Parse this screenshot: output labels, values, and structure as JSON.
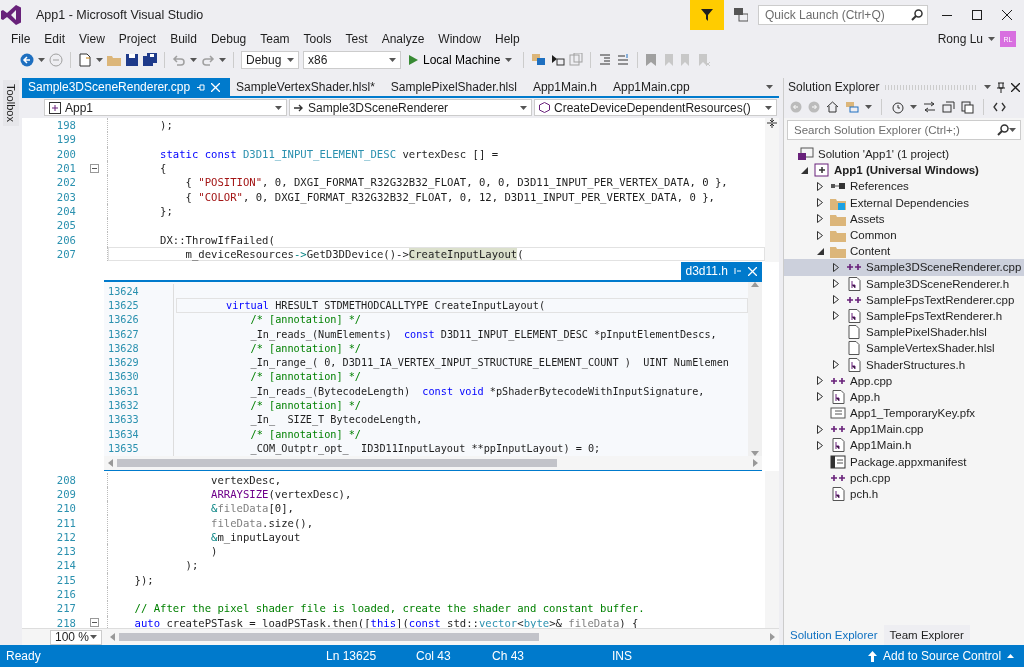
{
  "window": {
    "title": "App1 - Microsoft Visual Studio",
    "quick_launch": {
      "placeholder": "Quick Launch (Ctrl+Q)"
    }
  },
  "menu": [
    "File",
    "Edit",
    "View",
    "Project",
    "Build",
    "Debug",
    "Team",
    "Tools",
    "Test",
    "Analyze",
    "Window",
    "Help"
  ],
  "account": {
    "name": "Rong Lu",
    "initials": "RL"
  },
  "toolbar": {
    "configuration": "Debug",
    "platform": "x86",
    "run": "Local Machine"
  },
  "toolbox": {
    "label": "Toolbox"
  },
  "tabs": [
    {
      "label": "Sample3DSceneRenderer.cpp",
      "selected": true
    },
    {
      "label": "SampleVertexShader.hlsl*",
      "selected": false
    },
    {
      "label": "SamplePixelShader.hlsl",
      "selected": false
    },
    {
      "label": "App1Main.h",
      "selected": false
    },
    {
      "label": "App1Main.cpp",
      "selected": false
    }
  ],
  "navigation": [
    "App1",
    "Sample3DSceneRenderer",
    "CreateDeviceDependentResources()"
  ],
  "editor": {
    "top_lines": [
      {
        "number": "198",
        "tokens": [
          {
            "kind": "plain",
            "text": "        );"
          }
        ]
      },
      {
        "number": "199"
      },
      {
        "number": "200",
        "tokens": [
          {
            "kind": "keyword",
            "text": "        static const "
          },
          {
            "kind": "type",
            "text": "D3D11_INPUT_ELEMENT_DESC"
          },
          {
            "kind": "plain",
            "text": " vertexDesc [] ="
          }
        ]
      },
      {
        "number": "201",
        "fold": true,
        "tokens": [
          {
            "kind": "plain",
            "text": "        {"
          }
        ]
      },
      {
        "number": "202",
        "tokens": [
          {
            "kind": "plain",
            "text": "            { "
          },
          {
            "kind": "string",
            "text": "\"POSITION\""
          },
          {
            "kind": "plain",
            "text": ", 0, DXGI_FORMAT_R32G32B32_FLOAT, 0, 0, D3D11_INPUT_PER_VERTEX_DATA, 0 },"
          }
        ]
      },
      {
        "number": "203",
        "tokens": [
          {
            "kind": "plain",
            "text": "            { "
          },
          {
            "kind": "string",
            "text": "\"COLOR\""
          },
          {
            "kind": "plain",
            "text": ", 0, DXGI_FORMAT_R32G32B32_FLOAT, 0, 12, D3D11_INPUT_PER_VERTEX_DATA, 0 },"
          }
        ]
      },
      {
        "number": "204",
        "tokens": [
          {
            "kind": "plain",
            "text": "        };"
          }
        ]
      },
      {
        "number": "205"
      },
      {
        "number": "206",
        "tokens": [
          {
            "kind": "plain",
            "text": "        DX::ThrowIfFailed("
          }
        ]
      },
      {
        "number": "207",
        "current": true,
        "tokens": [
          {
            "kind": "plain",
            "text": "            m_deviceResources"
          },
          {
            "kind": "operator",
            "text": "->"
          },
          {
            "kind": "plain",
            "text": "GetD3DDevice()->"
          },
          {
            "kind": "reference",
            "text": "CreateInputLayout"
          },
          {
            "kind": "plain",
            "text": "("
          }
        ]
      }
    ],
    "peek": {
      "file": "d3d11.h",
      "lines": [
        {
          "number": "13624"
        },
        {
          "number": "13625",
          "current": true,
          "tokens": [
            {
              "kind": "keyword",
              "text": "        virtual"
            },
            {
              "kind": "plain",
              "text": " HRESULT STDMETHODCALLTYPE CreateInputLayout("
            }
          ]
        },
        {
          "number": "13626",
          "tokens": [
            {
              "kind": "comment",
              "text": "            /* [annotation] */"
            }
          ]
        },
        {
          "number": "13627",
          "tokens": [
            {
              "kind": "plain",
              "text": "            _In_reads_(NumElements)  "
            },
            {
              "kind": "keyword",
              "text": "const"
            },
            {
              "kind": "plain",
              "text": " D3D11_INPUT_ELEMENT_DESC *pInputElementDescs,"
            }
          ]
        },
        {
          "number": "13628",
          "tokens": [
            {
              "kind": "comment",
              "text": "            /* [annotation] */"
            }
          ]
        },
        {
          "number": "13629",
          "tokens": [
            {
              "kind": "plain",
              "text": "            _In_range_( 0, D3D11_IA_VERTEX_INPUT_STRUCTURE_ELEMENT_COUNT )  UINT NumElemen"
            }
          ]
        },
        {
          "number": "13630",
          "tokens": [
            {
              "kind": "comment",
              "text": "            /* [annotation] */"
            }
          ]
        },
        {
          "number": "13631",
          "tokens": [
            {
              "kind": "plain",
              "text": "            _In_reads_(BytecodeLength)  "
            },
            {
              "kind": "keyword",
              "text": "const void"
            },
            {
              "kind": "plain",
              "text": " *pShaderBytecodeWithInputSignature,"
            }
          ]
        },
        {
          "number": "13632",
          "tokens": [
            {
              "kind": "comment",
              "text": "            /* [annotation] */"
            }
          ]
        },
        {
          "number": "13633",
          "tokens": [
            {
              "kind": "plain",
              "text": "            _In_  SIZE_T BytecodeLength,"
            }
          ]
        },
        {
          "number": "13634",
          "tokens": [
            {
              "kind": "comment",
              "text": "            /* [annotation] */"
            }
          ]
        },
        {
          "number": "13635",
          "tokens": [
            {
              "kind": "plain",
              "text": "            _COM_Outptr_opt_  ID3D11InputLayout **ppInputLayout) = 0;"
            }
          ]
        }
      ]
    },
    "bottom_lines": [
      {
        "number": "208",
        "tokens": [
          {
            "kind": "plain",
            "text": "                vertexDesc,"
          }
        ]
      },
      {
        "number": "209",
        "tokens": [
          {
            "kind": "macro",
            "text": "                ARRAYSIZE"
          },
          {
            "kind": "plain",
            "text": "(vertexDesc),"
          }
        ]
      },
      {
        "number": "210",
        "tokens": [
          {
            "kind": "operator",
            "text": "                &"
          },
          {
            "kind": "param",
            "text": "fileData"
          },
          {
            "kind": "plain",
            "text": "[0],"
          }
        ]
      },
      {
        "number": "211",
        "tokens": [
          {
            "kind": "param",
            "text": "                fileData"
          },
          {
            "kind": "plain",
            "text": ".size(),"
          }
        ]
      },
      {
        "number": "212",
        "tokens": [
          {
            "kind": "operator",
            "text": "                &"
          },
          {
            "kind": "plain",
            "text": "m_inputLayout"
          }
        ]
      },
      {
        "number": "213",
        "tokens": [
          {
            "kind": "plain",
            "text": "                )"
          }
        ]
      },
      {
        "number": "214",
        "tokens": [
          {
            "kind": "plain",
            "text": "            );"
          }
        ]
      },
      {
        "number": "215",
        "tokens": [
          {
            "kind": "plain",
            "text": "    });"
          }
        ]
      },
      {
        "number": "216"
      },
      {
        "number": "217",
        "tokens": [
          {
            "kind": "comment",
            "text": "    // After the pixel shader file is loaded, create the shader and constant buffer."
          }
        ]
      },
      {
        "number": "218",
        "fold": true,
        "tokens": [
          {
            "kind": "keyword",
            "text": "    auto"
          },
          {
            "kind": "plain",
            "text": " createPSTask = loadPSTask.then(["
          },
          {
            "kind": "keyword",
            "text": "this"
          },
          {
            "kind": "plain",
            "text": "]("
          },
          {
            "kind": "keyword",
            "text": "const"
          },
          {
            "kind": "plain",
            "text": " std::"
          },
          {
            "kind": "type",
            "text": "vector"
          },
          {
            "kind": "plain",
            "text": "<"
          },
          {
            "kind": "type",
            "text": "byte"
          },
          {
            "kind": "plain",
            "text": ">& "
          },
          {
            "kind": "param",
            "text": "fileData"
          },
          {
            "kind": "plain",
            "text": ") {"
          }
        ]
      }
    ],
    "zoom": "100 %"
  },
  "solution_explorer": {
    "title": "Solution Explorer",
    "search": {
      "placeholder": "Search Solution Explorer (Ctrl+;)"
    },
    "tree": [
      {
        "label": "Solution 'App1' (1 project)",
        "kind": "solution",
        "selected": false,
        "children": [
          {
            "label": "App1 (Universal Windows)",
            "kind": "project",
            "expanded": true,
            "selected": false,
            "children": [
              {
                "label": "References",
                "kind": "references",
                "expanded": false,
                "selected": false
              },
              {
                "label": "External Dependencies",
                "kind": "external",
                "expanded": false,
                "selected": false
              },
              {
                "label": "Assets",
                "kind": "folder",
                "expanded": false,
                "selected": false
              },
              {
                "label": "Common",
                "kind": "folder",
                "expanded": false,
                "selected": false
              },
              {
                "label": "Content",
                "kind": "folder",
                "expanded": true,
                "selected": false,
                "children": [
                  {
                    "label": "Sample3DSceneRenderer.cpp",
                    "kind": "cpp",
                    "expanded": false,
                    "selected": true
                  },
                  {
                    "label": "Sample3DSceneRenderer.h",
                    "kind": "header",
                    "expanded": false,
                    "selected": false
                  },
                  {
                    "label": "SampleFpsTextRenderer.cpp",
                    "kind": "cpp",
                    "expanded": false,
                    "selected": false
                  },
                  {
                    "label": "SampleFpsTextRenderer.h",
                    "kind": "header",
                    "expanded": false,
                    "selected": false
                  },
                  {
                    "label": "SamplePixelShader.hlsl",
                    "kind": "file",
                    "selected": false
                  },
                  {
                    "label": "SampleVertexShader.hlsl",
                    "kind": "file",
                    "selected": false
                  },
                  {
                    "label": "ShaderStructures.h",
                    "kind": "header",
                    "expanded": false,
                    "selected": false
                  }
                ]
              },
              {
                "label": "App.cpp",
                "kind": "cpp",
                "expanded": false,
                "selected": false
              },
              {
                "label": "App.h",
                "kind": "header",
                "expanded": false,
                "selected": false
              },
              {
                "label": "App1_TemporaryKey.pfx",
                "kind": "certificate",
                "selected": false
              },
              {
                "label": "App1Main.cpp",
                "kind": "cpp",
                "expanded": false,
                "selected": false
              },
              {
                "label": "App1Main.h",
                "kind": "header",
                "expanded": false,
                "selected": false
              },
              {
                "label": "Package.appxmanifest",
                "kind": "manifest",
                "selected": false
              },
              {
                "label": "pch.cpp",
                "kind": "cpp",
                "selected": false
              },
              {
                "label": "pch.h",
                "kind": "header",
                "selected": false
              }
            ]
          }
        ]
      }
    ],
    "tabs": [
      {
        "label": "Solution Explorer",
        "selected": true
      },
      {
        "label": "Team Explorer",
        "selected": false
      }
    ]
  },
  "status_bar": {
    "message": "Ready",
    "line": "Ln 13625",
    "column": "Col 43",
    "char": "Ch 43",
    "mode": "INS",
    "source_control": "Add to Source Control"
  }
}
